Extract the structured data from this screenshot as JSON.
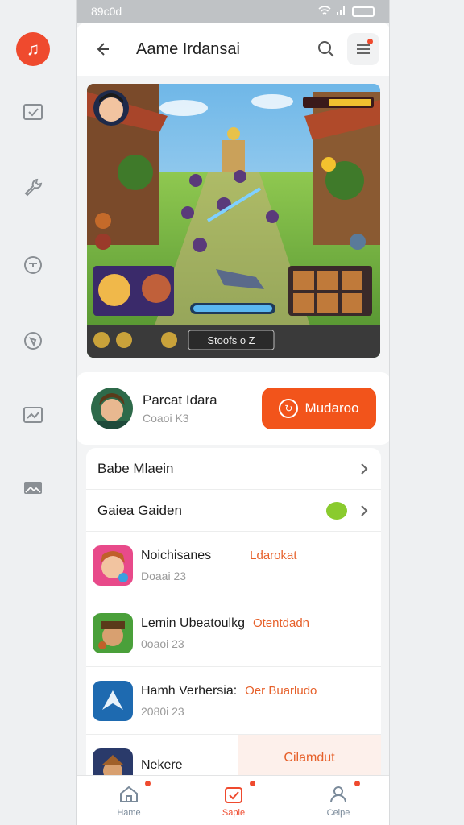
{
  "statusbar": {
    "time": "89c0d"
  },
  "header": {
    "title": "Aame Irdansai"
  },
  "game": {
    "score_label": "Stoofs o Z"
  },
  "player": {
    "name": "Parcat Idara",
    "sub": "Coaoi K3",
    "action_label": "Mudaroo"
  },
  "menu": [
    {
      "label": "Babe Mlaein"
    },
    {
      "label": "Gaiea Gaiden"
    }
  ],
  "games": [
    {
      "title": "Noichisanes",
      "tag": "Ldarokat",
      "sub": "Doaai 23"
    },
    {
      "title": "Lemin Ubeatoulkg",
      "tag": "Otentdadn",
      "sub": "0oaoi 23"
    },
    {
      "title": "Hamh Verhersia:",
      "tag": "Oer Buarludo",
      "sub": "2080i 23"
    },
    {
      "title": "Nekere",
      "tag": "Cilamdut",
      "sub": ""
    }
  ],
  "tabs": [
    {
      "label": "Hame"
    },
    {
      "label": "Saple"
    },
    {
      "label": "Ceipe"
    }
  ],
  "colors": {
    "accent": "#F2541B",
    "chat": "#8ACB2E"
  }
}
